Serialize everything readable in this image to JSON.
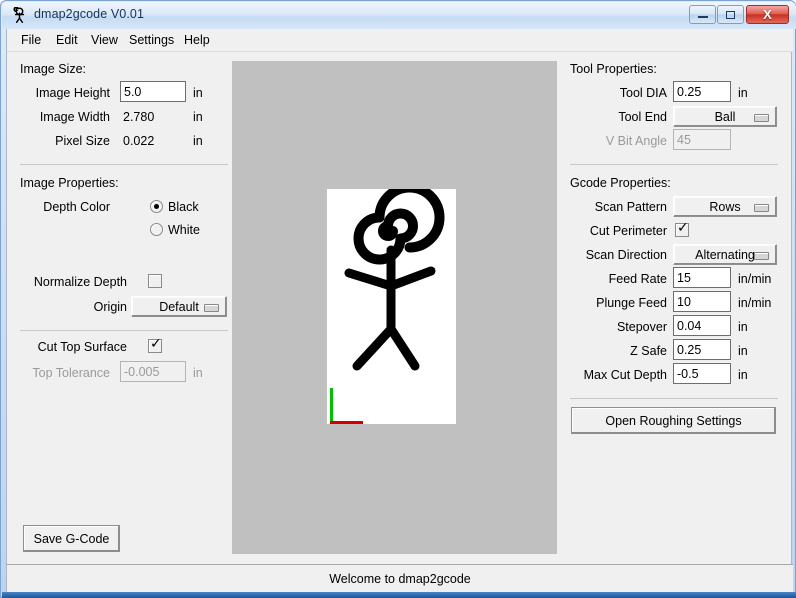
{
  "window": {
    "title": "dmap2gcode V0.01",
    "icon": "stick-figure-icon",
    "controls": {
      "minimize": "–",
      "maximize": "□",
      "close": "X"
    }
  },
  "menubar": {
    "items": [
      {
        "label": "File"
      },
      {
        "label": "Edit"
      },
      {
        "label": "View"
      },
      {
        "label": "Settings"
      },
      {
        "label": "Help"
      }
    ]
  },
  "left_panel": {
    "image_size": {
      "heading": "Image Size:",
      "image_height": {
        "label": "Image Height",
        "value": "5.0",
        "unit": "in"
      },
      "image_width": {
        "label": "Image Width",
        "value": "2.780",
        "unit": "in"
      },
      "pixel_size": {
        "label": "Pixel Size",
        "value": "0.022",
        "unit": "in"
      }
    },
    "image_properties": {
      "heading": "Image Properties:",
      "depth_color": {
        "label": "Depth Color",
        "selected": "Black",
        "options": [
          "Black",
          "White"
        ]
      },
      "normalize_depth": {
        "label": "Normalize Depth",
        "checked": false
      },
      "origin": {
        "label": "Origin",
        "value": "Default"
      }
    },
    "cut_top": {
      "cut_top_surface": {
        "label": "Cut Top Surface",
        "checked": true
      },
      "top_tolerance": {
        "label": "Top Tolerance",
        "value": "-0.005",
        "unit": "in",
        "disabled": true
      }
    },
    "save_button": "Save G-Code"
  },
  "right_panel": {
    "tool_properties": {
      "heading": "Tool Properties:",
      "tool_dia": {
        "label": "Tool DIA",
        "value": "0.25",
        "unit": "in"
      },
      "tool_end": {
        "label": "Tool End",
        "value": "Ball"
      },
      "v_bit_angle": {
        "label": "V Bit Angle",
        "value": "45",
        "disabled": true
      }
    },
    "gcode_properties": {
      "heading": "Gcode Properties:",
      "scan_pattern": {
        "label": "Scan Pattern",
        "value": "Rows"
      },
      "cut_perimeter": {
        "label": "Cut Perimeter",
        "checked": true
      },
      "scan_direction": {
        "label": "Scan Direction",
        "value": "Alternating"
      },
      "feed_rate": {
        "label": "Feed Rate",
        "value": "15",
        "unit": "in/min"
      },
      "plunge_feed": {
        "label": "Plunge Feed",
        "value": "10",
        "unit": "in/min"
      },
      "stepover": {
        "label": "Stepover",
        "value": "0.04",
        "unit": "in"
      },
      "z_safe": {
        "label": "Z Safe",
        "value": "0.25",
        "unit": "in"
      },
      "max_cut_depth": {
        "label": "Max Cut Depth",
        "value": "-0.5",
        "unit": "in"
      }
    },
    "roughing_button": "Open Roughing Settings"
  },
  "canvas": {
    "background_color": "#c0c0c0",
    "image_background": "#ffffff",
    "drawing": "spiral-head-stick-figure",
    "origin_axes": {
      "x_axis_color": "#d40000",
      "y_axis_color": "#00c000"
    }
  },
  "statusbar": {
    "message": "Welcome to dmap2gcode"
  }
}
